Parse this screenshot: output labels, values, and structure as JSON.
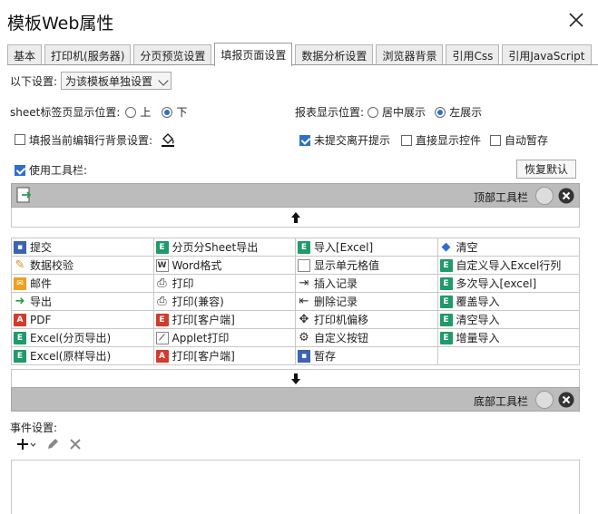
{
  "window": {
    "title": "模板Web属性"
  },
  "tabs": [
    {
      "label": "基本"
    },
    {
      "label": "打印机(服务器)"
    },
    {
      "label": "分页预览设置"
    },
    {
      "label": "填报页面设置"
    },
    {
      "label": "数据分析设置"
    },
    {
      "label": "浏览器背景"
    },
    {
      "label": "引用Css"
    },
    {
      "label": "引用JavaScript"
    }
  ],
  "settings": {
    "scope_label": "以下设置:",
    "scope_value": "为该模板单独设置",
    "sheet_tab_label": "sheet标签页显示位置:",
    "sheet_top": "上",
    "sheet_bottom": "下",
    "report_pos_label": "报表显示位置:",
    "report_center": "居中展示",
    "report_left": "左展示",
    "fill_bg_label": "填报当前编辑行背景设置:",
    "unsubmitted_label": "未提交离开提示",
    "show_control_label": "直接显示控件",
    "autosave_label": "自动暂存",
    "use_toolbar_label": "使用工具栏:",
    "restore_default": "恢复默认"
  },
  "toolbars": {
    "top_label": "顶部工具栏",
    "bottom_label": "底部工具栏"
  },
  "buttons_grid": [
    [
      {
        "label": "提交",
        "icon": "save-icon"
      },
      {
        "label": "分页分Sheet导出",
        "icon": "excel-icon"
      },
      {
        "label": "导入[Excel]",
        "icon": "excel-icon"
      },
      {
        "label": "清空",
        "icon": "eraser-icon"
      }
    ],
    [
      {
        "label": "数据校验",
        "icon": "pencil-icon"
      },
      {
        "label": "Word格式",
        "icon": "word-icon"
      },
      {
        "label": "显示单元格值",
        "icon": "cell-icon"
      },
      {
        "label": "自定义导入Excel行列",
        "icon": "excel-icon"
      }
    ],
    [
      {
        "label": "邮件",
        "icon": "mail-icon"
      },
      {
        "label": "打印",
        "icon": "print-icon"
      },
      {
        "label": "插入记录",
        "icon": "insert-row-icon"
      },
      {
        "label": "多次导入[excel]",
        "icon": "excel-icon"
      }
    ],
    [
      {
        "label": "导出",
        "icon": "export-icon"
      },
      {
        "label": "打印(兼容)",
        "icon": "print-icon"
      },
      {
        "label": "删除记录",
        "icon": "delete-row-icon"
      },
      {
        "label": "覆盖导入",
        "icon": "excel-icon"
      }
    ],
    [
      {
        "label": "PDF",
        "icon": "pdf-icon"
      },
      {
        "label": "打印[客户端]",
        "icon": "client-print-icon"
      },
      {
        "label": "打印机偏移",
        "icon": "move-icon"
      },
      {
        "label": "清空导入",
        "icon": "excel-icon"
      }
    ],
    [
      {
        "label": "Excel(分页导出)",
        "icon": "excel-icon"
      },
      {
        "label": "Applet打印",
        "icon": "applet-icon"
      },
      {
        "label": "自定义按钮",
        "icon": "gear-icon"
      },
      {
        "label": "增量导入",
        "icon": "excel-icon"
      }
    ],
    [
      {
        "label": "Excel(原样导出)",
        "icon": "excel-icon"
      },
      {
        "label": "打印[客户端]",
        "icon": "pdf-icon"
      },
      {
        "label": "暂存",
        "icon": "save-icon"
      },
      {
        "label": "",
        "icon": ""
      }
    ]
  ],
  "events": {
    "label": "事件设置:"
  }
}
